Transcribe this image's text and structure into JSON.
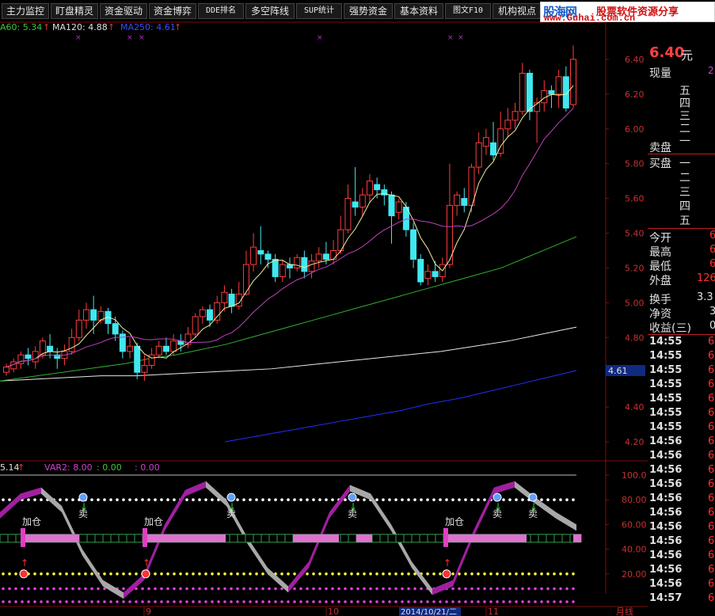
{
  "toolbar": {
    "tabs": [
      "主力监控",
      "盯盘精灵",
      "资金驱动",
      "资金博弈",
      "DDE排名",
      "多空阵线",
      "SUP统计",
      "强势资金",
      "基本资料",
      "图文F10",
      "机构视点"
    ]
  },
  "watermark": {
    "name": "股海网",
    "slogan": "股票软件资源分享",
    "url": "www.Guhai.com.cn"
  },
  "main_indicators": {
    "ma60": "A60: 5.34",
    "ma120": "MA120: 4.88",
    "ma250": "MA250: 4.61",
    "arrow": "↑"
  },
  "sub_indicators": {
    "var1": "5.14",
    "var2": "VAR2: 8.00",
    "v3": ": 0.00",
    "v4": ": 0.00",
    "arrow": "↑"
  },
  "price_axis": [
    "6.40",
    "6.20",
    "6.00",
    "5.80",
    "5.60",
    "5.40",
    "5.20",
    "5.00",
    "4.80",
    "4.60",
    "4.40",
    "4.20"
  ],
  "price_marker": "4.61",
  "osc_axis": [
    "100.0",
    "80.00",
    "60.00",
    "40.00",
    "20.00"
  ],
  "date_axis": {
    "labels": [
      "9",
      "10",
      "11"
    ],
    "highlight": "2014/10/21/二",
    "extra": "月线"
  },
  "signals": {
    "buy": "加仓",
    "sell": "卖"
  },
  "quote": {
    "price": "6.40",
    "unit": "元",
    "current_label": "现量",
    "current_value": "2",
    "ask_levels": [
      "五",
      "四",
      "三",
      "二",
      "一"
    ],
    "sell_label": "卖盘",
    "buy_label": "买盘",
    "bid_levels": [
      "一",
      "二",
      "三",
      "四",
      "五"
    ],
    "stats": [
      {
        "label": "今开",
        "value": "6"
      },
      {
        "label": "最高",
        "value": "6"
      },
      {
        "label": "最低",
        "value": "6"
      },
      {
        "label": "外盘",
        "value": "126"
      },
      {
        "label": "换手",
        "value": "3.3"
      },
      {
        "label": "净资",
        "value": "3"
      },
      {
        "label": "收益(三)",
        "value": "0"
      }
    ],
    "ticks": [
      "14:55",
      "14:55",
      "14:55",
      "14:55",
      "14:55",
      "14:55",
      "14:55",
      "14:56",
      "14:56",
      "14:56",
      "14:56",
      "14:56",
      "14:56",
      "14:56",
      "14:56",
      "14:56",
      "14:56",
      "14:56",
      "14:57"
    ],
    "tick_price": "6"
  },
  "chart_data": {
    "type": "candlestick",
    "ylim": [
      4.1,
      6.55
    ],
    "candles": [
      [
        4.6,
        4.63,
        4.58,
        4.65
      ],
      [
        4.62,
        4.66,
        4.6,
        4.68
      ],
      [
        4.65,
        4.7,
        4.62,
        4.72
      ],
      [
        4.7,
        4.68,
        4.64,
        4.74
      ],
      [
        4.66,
        4.72,
        4.62,
        4.75
      ],
      [
        4.7,
        4.78,
        4.68,
        4.8
      ],
      [
        4.75,
        4.72,
        4.68,
        4.82
      ],
      [
        4.7,
        4.68,
        4.62,
        4.74
      ],
      [
        4.68,
        4.72,
        4.64,
        4.76
      ],
      [
        4.72,
        4.8,
        4.7,
        4.85
      ],
      [
        4.8,
        4.9,
        4.78,
        4.96
      ],
      [
        4.9,
        4.96,
        4.85,
        5.0
      ],
      [
        4.96,
        4.9,
        4.82,
        5.04
      ],
      [
        4.9,
        4.95,
        4.88,
        4.98
      ],
      [
        4.95,
        4.88,
        4.82,
        4.97
      ],
      [
        4.88,
        4.82,
        4.78,
        4.92
      ],
      [
        4.82,
        4.72,
        4.68,
        4.84
      ],
      [
        4.72,
        4.75,
        4.68,
        4.8
      ],
      [
        4.75,
        4.6,
        4.56,
        4.77
      ],
      [
        4.6,
        4.64,
        4.55,
        4.7
      ],
      [
        4.64,
        4.7,
        4.62,
        4.74
      ],
      [
        4.7,
        4.75,
        4.68,
        4.78
      ],
      [
        4.75,
        4.72,
        4.7,
        4.8
      ],
      [
        4.72,
        4.78,
        4.7,
        4.82
      ],
      [
        4.78,
        4.76,
        4.72,
        4.82
      ],
      [
        4.76,
        4.82,
        4.74,
        4.86
      ],
      [
        4.82,
        4.92,
        4.8,
        4.94
      ],
      [
        4.92,
        4.96,
        4.88,
        4.98
      ],
      [
        4.96,
        4.9,
        4.86,
        4.99
      ],
      [
        4.9,
        5.0,
        4.88,
        5.04
      ],
      [
        5.0,
        5.06,
        4.95,
        5.1
      ],
      [
        5.05,
        4.98,
        4.94,
        5.08
      ],
      [
        4.98,
        5.05,
        4.96,
        5.12
      ],
      [
        5.05,
        5.22,
        5.04,
        5.3
      ],
      [
        5.22,
        5.32,
        5.18,
        5.4
      ],
      [
        5.3,
        5.28,
        5.22,
        5.44
      ],
      [
        5.28,
        5.25,
        5.2,
        5.3
      ],
      [
        5.25,
        5.15,
        5.12,
        5.28
      ],
      [
        5.15,
        5.22,
        5.12,
        5.25
      ],
      [
        5.22,
        5.2,
        5.14,
        5.26
      ],
      [
        5.2,
        5.26,
        5.18,
        5.28
      ],
      [
        5.26,
        5.18,
        5.14,
        5.3
      ],
      [
        5.18,
        5.24,
        5.14,
        5.28
      ],
      [
        5.24,
        5.28,
        5.2,
        5.32
      ],
      [
        5.28,
        5.25,
        5.22,
        5.35
      ],
      [
        5.25,
        5.3,
        5.22,
        5.36
      ],
      [
        5.3,
        5.42,
        5.28,
        5.5
      ],
      [
        5.42,
        5.6,
        5.4,
        5.68
      ],
      [
        5.58,
        5.55,
        5.5,
        5.78
      ],
      [
        5.55,
        5.62,
        5.5,
        5.66
      ],
      [
        5.62,
        5.7,
        5.58,
        5.74
      ],
      [
        5.68,
        5.65,
        5.6,
        5.72
      ],
      [
        5.65,
        5.62,
        5.56,
        5.68
      ],
      [
        5.62,
        5.5,
        5.34,
        5.64
      ],
      [
        5.52,
        5.58,
        5.48,
        5.6
      ],
      [
        5.55,
        5.42,
        5.38,
        5.58
      ],
      [
        5.42,
        5.25,
        5.2,
        5.46
      ],
      [
        5.25,
        5.12,
        5.1,
        5.28
      ],
      [
        5.14,
        5.18,
        5.1,
        5.22
      ],
      [
        5.18,
        5.15,
        5.12,
        5.24
      ],
      [
        5.15,
        5.22,
        5.12,
        5.26
      ],
      [
        5.22,
        5.56,
        5.2,
        5.8
      ],
      [
        5.56,
        5.62,
        5.5,
        5.64
      ],
      [
        5.6,
        5.56,
        5.52,
        5.66
      ],
      [
        5.56,
        5.78,
        5.52,
        5.8
      ],
      [
        5.78,
        5.92,
        5.74,
        5.98
      ],
      [
        5.9,
        5.95,
        5.85,
        6.0
      ],
      [
        5.92,
        5.85,
        5.82,
        6.04
      ],
      [
        5.86,
        6.0,
        5.84,
        6.1
      ],
      [
        6.0,
        6.05,
        5.95,
        6.12
      ],
      [
        6.05,
        6.1,
        6.0,
        6.15
      ],
      [
        6.1,
        6.32,
        6.08,
        6.38
      ],
      [
        6.32,
        6.1,
        6.05,
        6.34
      ],
      [
        6.1,
        6.15,
        5.92,
        6.18
      ],
      [
        6.15,
        6.22,
        6.1,
        6.28
      ],
      [
        6.22,
        6.2,
        6.12,
        6.25
      ],
      [
        6.2,
        6.3,
        6.12,
        6.34
      ],
      [
        6.3,
        6.12,
        6.1,
        6.36
      ],
      [
        6.14,
        6.4,
        6.12,
        6.48
      ]
    ],
    "ma60": [
      4.55,
      4.57,
      4.59,
      4.61,
      4.63,
      4.65,
      4.68,
      4.7,
      4.73,
      4.76,
      4.8,
      4.84,
      4.88,
      4.92,
      4.96,
      5.0,
      5.04,
      5.08,
      5.12,
      5.16,
      5.2,
      5.26,
      5.32,
      5.38
    ],
    "ma120": [
      4.55,
      4.56,
      4.57,
      4.58,
      4.58,
      4.59,
      4.6,
      4.61,
      4.62,
      4.64,
      4.66,
      4.68,
      4.7,
      4.72,
      4.75,
      4.78,
      4.82,
      4.86
    ],
    "ma250": [
      4.2,
      4.23,
      4.26,
      4.29,
      4.32,
      4.35,
      4.38,
      4.42,
      4.45,
      4.49,
      4.53,
      4.57,
      4.61
    ],
    "oscillator": [
      70,
      85,
      90,
      75,
      40,
      15,
      5,
      20,
      60,
      88,
      95,
      80,
      50,
      25,
      10,
      30,
      70,
      92,
      85,
      60,
      30,
      8,
      15,
      55,
      90,
      95,
      82,
      70,
      60
    ]
  }
}
